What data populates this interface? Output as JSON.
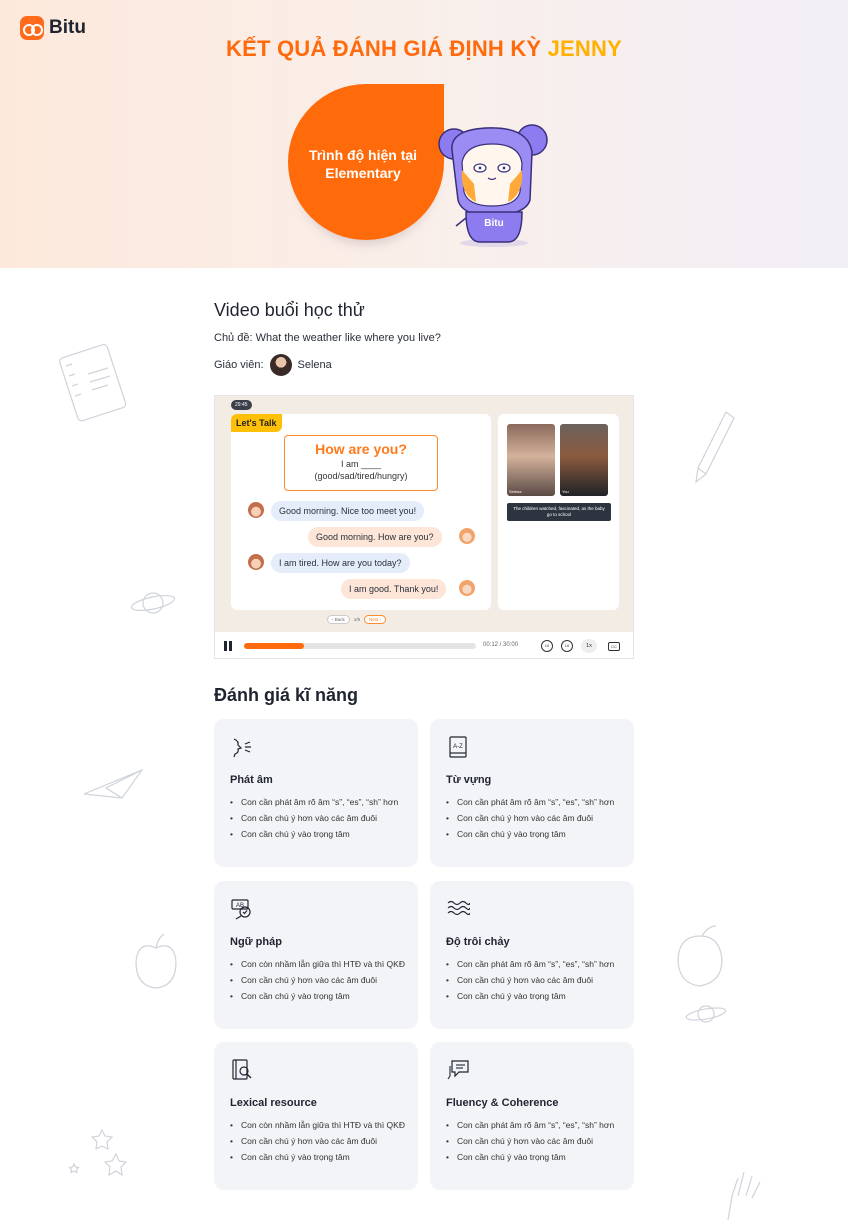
{
  "brand": {
    "name": "Bitu"
  },
  "hero": {
    "title_prefix": "KẾT QUẢ ĐÁNH GIÁ ĐỊNH KỲ",
    "student_name": "JENNY",
    "level_line1": "Trình độ hiện tại",
    "level_line2": "Elementary",
    "mascot_label": "Bitu"
  },
  "video_section": {
    "title": "Video buổi học thử",
    "topic": "Chủ đề: What the weather like where you live?",
    "teacher_label": "Giáo viên:",
    "teacher_name": "Selena"
  },
  "video": {
    "badge_time": "29:45",
    "lets_talk": "Let's Talk",
    "question": "How are you?",
    "prompt_line1": "I am ____",
    "prompt_line2": "(good/sad/tired/hungry)",
    "messages": [
      {
        "side": "left",
        "text": "Good morning. Nice too meet you!"
      },
      {
        "side": "right",
        "text": "Good morning. How are you?"
      },
      {
        "side": "left",
        "text": "I am tired. How are you today?"
      },
      {
        "side": "right",
        "text": "I am good. Thank you!"
      }
    ],
    "pager": {
      "back": "‹ Back",
      "page": "1/9",
      "next": "Next ›"
    },
    "cam_a_label": "Selena",
    "cam_b_label": "You",
    "subtitle": "The children watched, fascinated, as the baby go to school",
    "progress": 0.26,
    "time_display": "00:12 / 30:00",
    "rewind_label": "10",
    "forward_label": "10",
    "speed": "1x",
    "cc_label": "CC"
  },
  "skills": {
    "title": "Đánh giá kĩ năng",
    "cards": [
      {
        "icon": "mouth-speaking-icon",
        "title": "Phát âm",
        "items": [
          "Con cần phát âm rõ âm “s”, “es”, “sh” hơn",
          "Con cần chú ý hơn vào các âm đuôi",
          "Con cần chú ý vào trọng tâm"
        ]
      },
      {
        "icon": "dictionary-icon",
        "title": "Từ vựng",
        "items": [
          "Con cần phát âm rõ âm “s”, “es”, “sh” hơn",
          "Con cần chú ý hơn vào các âm đuôi",
          "Con cần chú ý vào trọng tâm"
        ]
      },
      {
        "icon": "grammar-check-icon",
        "title": "Ngữ pháp",
        "items": [
          "Con còn nhầm lẫn giữa thì HTĐ và thì QKĐ",
          "Con cần chú ý hơn vào các âm đuôi",
          "Con cần chú ý vào trọng tâm"
        ]
      },
      {
        "icon": "waves-icon",
        "title": "Độ trôi chảy",
        "items": [
          "Con cần phát âm rõ âm “s”, “es”, “sh” hơn",
          "Con cần chú ý hơn vào các âm đuôi",
          "Con cần chú ý vào trọng tâm"
        ]
      },
      {
        "icon": "book-search-icon",
        "title": "Lexical resource",
        "items": [
          "Con còn nhầm lẫn giữa thì HTĐ và thì QKĐ",
          "Con cần chú ý hơn vào các âm đuôi",
          "Con cần chú ý vào trọng tâm"
        ]
      },
      {
        "icon": "chat-icon",
        "title": "Fluency & Coherence",
        "items": [
          "Con cần phát âm rõ âm “s”, “es”, “sh” hơn",
          "Con cần chú ý hơn vào các âm đuôi",
          "Con cần chú ý vào trọng tâm"
        ]
      }
    ]
  },
  "colors": {
    "accent": "#ff6b0a",
    "name_yellow": "#ffb000",
    "mascot": "#8c7cf0",
    "card_bg": "#f2f4f7"
  }
}
